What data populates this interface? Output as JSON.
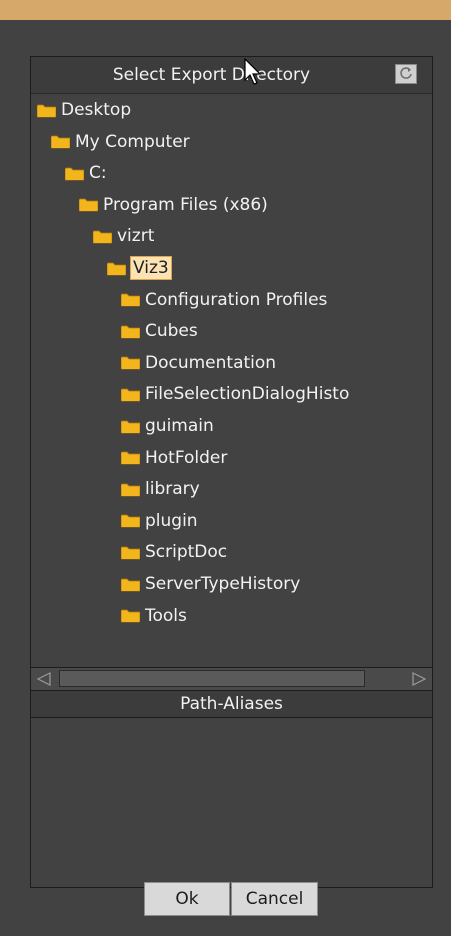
{
  "dialog": {
    "title": "Select Export Directory",
    "refresh_icon": "refresh-icon"
  },
  "tree": {
    "nodes": [
      {
        "label": "Desktop",
        "depth": 0
      },
      {
        "label": "My Computer",
        "depth": 1
      },
      {
        "label": "C:",
        "depth": 2
      },
      {
        "label": "Program Files (x86)",
        "depth": 3
      },
      {
        "label": "vizrt",
        "depth": 4
      },
      {
        "label": "Viz3",
        "depth": 5,
        "selected": true
      },
      {
        "label": "Configuration Profiles",
        "depth": 6
      },
      {
        "label": "Cubes",
        "depth": 6
      },
      {
        "label": "Documentation",
        "depth": 6
      },
      {
        "label": "FileSelectionDialogHisto",
        "depth": 6
      },
      {
        "label": "guimain",
        "depth": 6
      },
      {
        "label": "HotFolder",
        "depth": 6
      },
      {
        "label": "library",
        "depth": 6
      },
      {
        "label": "plugin",
        "depth": 6
      },
      {
        "label": "ScriptDoc",
        "depth": 6
      },
      {
        "label": "ServerTypeHistory",
        "depth": 6
      },
      {
        "label": "Tools",
        "depth": 6
      }
    ]
  },
  "path_aliases": {
    "header": "Path-Aliases"
  },
  "buttons": {
    "ok": "Ok",
    "cancel": "Cancel"
  },
  "colors": {
    "folder": "#f3b51c",
    "selected_bg": "#fbe3b6",
    "background": "#424242"
  }
}
